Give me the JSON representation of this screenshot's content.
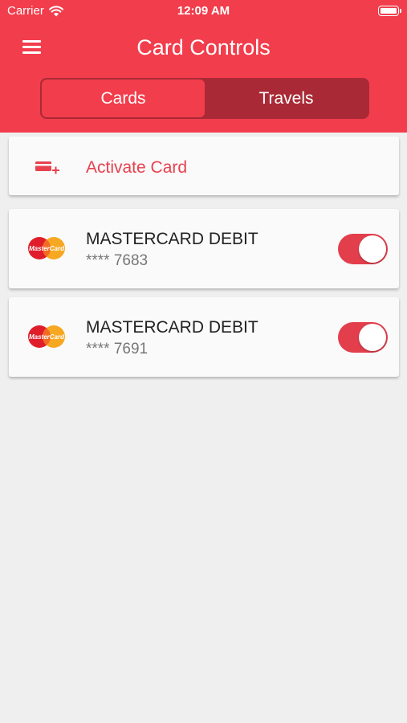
{
  "status_bar": {
    "carrier": "Carrier",
    "time": "12:09 AM"
  },
  "header": {
    "title": "Card Controls",
    "background_color": "#f23d4c"
  },
  "tabs": [
    {
      "label": "Cards",
      "selected": true
    },
    {
      "label": "Travels",
      "selected": false
    }
  ],
  "activate": {
    "label": "Activate Card",
    "icon": "add-card-icon"
  },
  "cards": [
    {
      "logo": "mastercard-logo",
      "logo_text": "MasterCard",
      "name": "MASTERCARD DEBIT",
      "number": "**** 7683",
      "enabled": true
    },
    {
      "logo": "mastercard-logo",
      "logo_text": "MasterCard",
      "name": "MASTERCARD DEBIT",
      "number": "**** 7691",
      "enabled": true
    }
  ],
  "colors": {
    "accent": "#f23d4c",
    "segment_dark": "#a92a36",
    "toggle_on": "#e33e4c",
    "background": "#efefef"
  }
}
